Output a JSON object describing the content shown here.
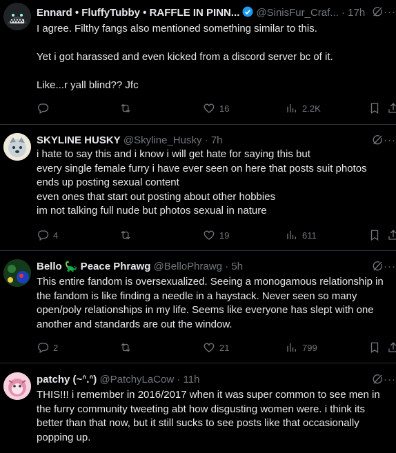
{
  "tweets": [
    {
      "name": "Ennard • FluffyTubby • RAFFLE IN PINN...",
      "handle": "@SinisFur_Craf...",
      "time": "17h",
      "text": "I agree. Filthy fangs also mentioned something similar to this.\n\nYet i got harassed and even kicked from a discord server bc of it.\n\nLike...r yall blind?? Jfc",
      "reply_count": "",
      "retweet_count": "",
      "like_count": "16",
      "view_count": "2.2K",
      "verified": true
    },
    {
      "name": "SKYLINE HUSKY",
      "handle": "@Skyline_Husky",
      "time": "7h",
      "text": "i hate to say this and i know i will get hate for saying this but\nevery single female furry i have ever seen on here that posts suit photos\nends up posting sexual content\neven ones that start out posting about other hobbies\nim not talking full nude but photos sexual in nature",
      "reply_count": "4",
      "retweet_count": "",
      "like_count": "19",
      "view_count": "611",
      "verified": false
    },
    {
      "name": "Bello 🦕 Peace Phrawg",
      "handle": "@BelloPhrawg",
      "time": "5h",
      "text": "This entire fandom is oversexualized. Seeing a monogamous relationship in\nthe fandom is like finding a needle in a haystack. Never seen so many\nopen/poly relationships in my life. Seems like everyone has slept with one\nanother and standards are out the window.",
      "reply_count": "2",
      "retweet_count": "",
      "like_count": "21",
      "view_count": "799",
      "verified": false
    },
    {
      "name": "patchy (~ᐢ.ᐢ)",
      "handle": "@PatchyLaCow",
      "time": "11h",
      "text": "THIS!!! i remember in 2016/2017 when it was super common to see men in\nthe furry community tweeting abt how disgusting women were. i think its\nbetter than that now, but it still sucks to see posts like that occasionally\npopping up.",
      "verified": false
    }
  ],
  "separator": "·",
  "more_glyph": "···",
  "colors": {
    "background": "#000000",
    "text": "#e7e9ea",
    "muted": "#71767b",
    "divider": "#2f3336",
    "verified": "#1d9bf0"
  },
  "icons": [
    "reply-icon",
    "retweet-icon",
    "like-icon",
    "views-icon",
    "bookmark-icon",
    "share-icon",
    "grok-icon",
    "verified-icon"
  ]
}
